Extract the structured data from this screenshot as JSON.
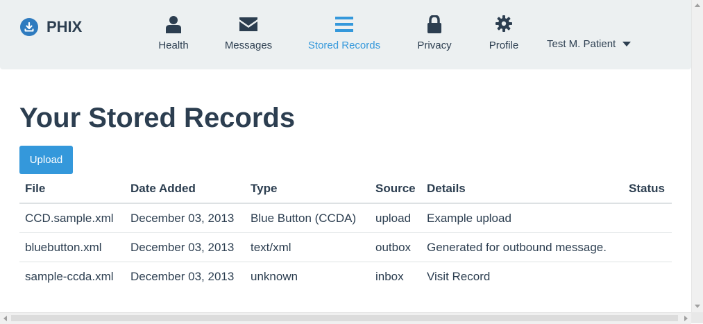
{
  "brand": {
    "name": "PHIX",
    "icon": "download-circle-icon",
    "color": "#2e7bbf"
  },
  "nav": {
    "items": [
      {
        "label": "Health",
        "icon": "user-icon"
      },
      {
        "label": "Messages",
        "icon": "envelope-icon"
      },
      {
        "label": "Stored Records",
        "icon": "list-icon",
        "active": true
      },
      {
        "label": "Privacy",
        "icon": "lock-icon"
      },
      {
        "label": "Profile",
        "icon": "gear-icon"
      }
    ],
    "user": "Test M. Patient"
  },
  "page": {
    "title": "Your Stored Records",
    "upload_label": "Upload"
  },
  "table": {
    "columns": [
      "File",
      "Date Added",
      "Type",
      "Source",
      "Details",
      "Status"
    ],
    "rows": [
      [
        "CCD.sample.xml",
        "December 03, 2013",
        "Blue Button (CCDA)",
        "upload",
        "Example upload",
        ""
      ],
      [
        "bluebutton.xml",
        "December 03, 2013",
        "text/xml",
        "outbox",
        "Generated for outbound message.",
        ""
      ],
      [
        "sample-ccda.xml",
        "December 03, 2013",
        "unknown",
        "inbox",
        "Visit Record",
        ""
      ]
    ]
  },
  "colors": {
    "accent": "#3498db",
    "text": "#2c3e50",
    "navbar_bg": "#ecf0f1"
  }
}
